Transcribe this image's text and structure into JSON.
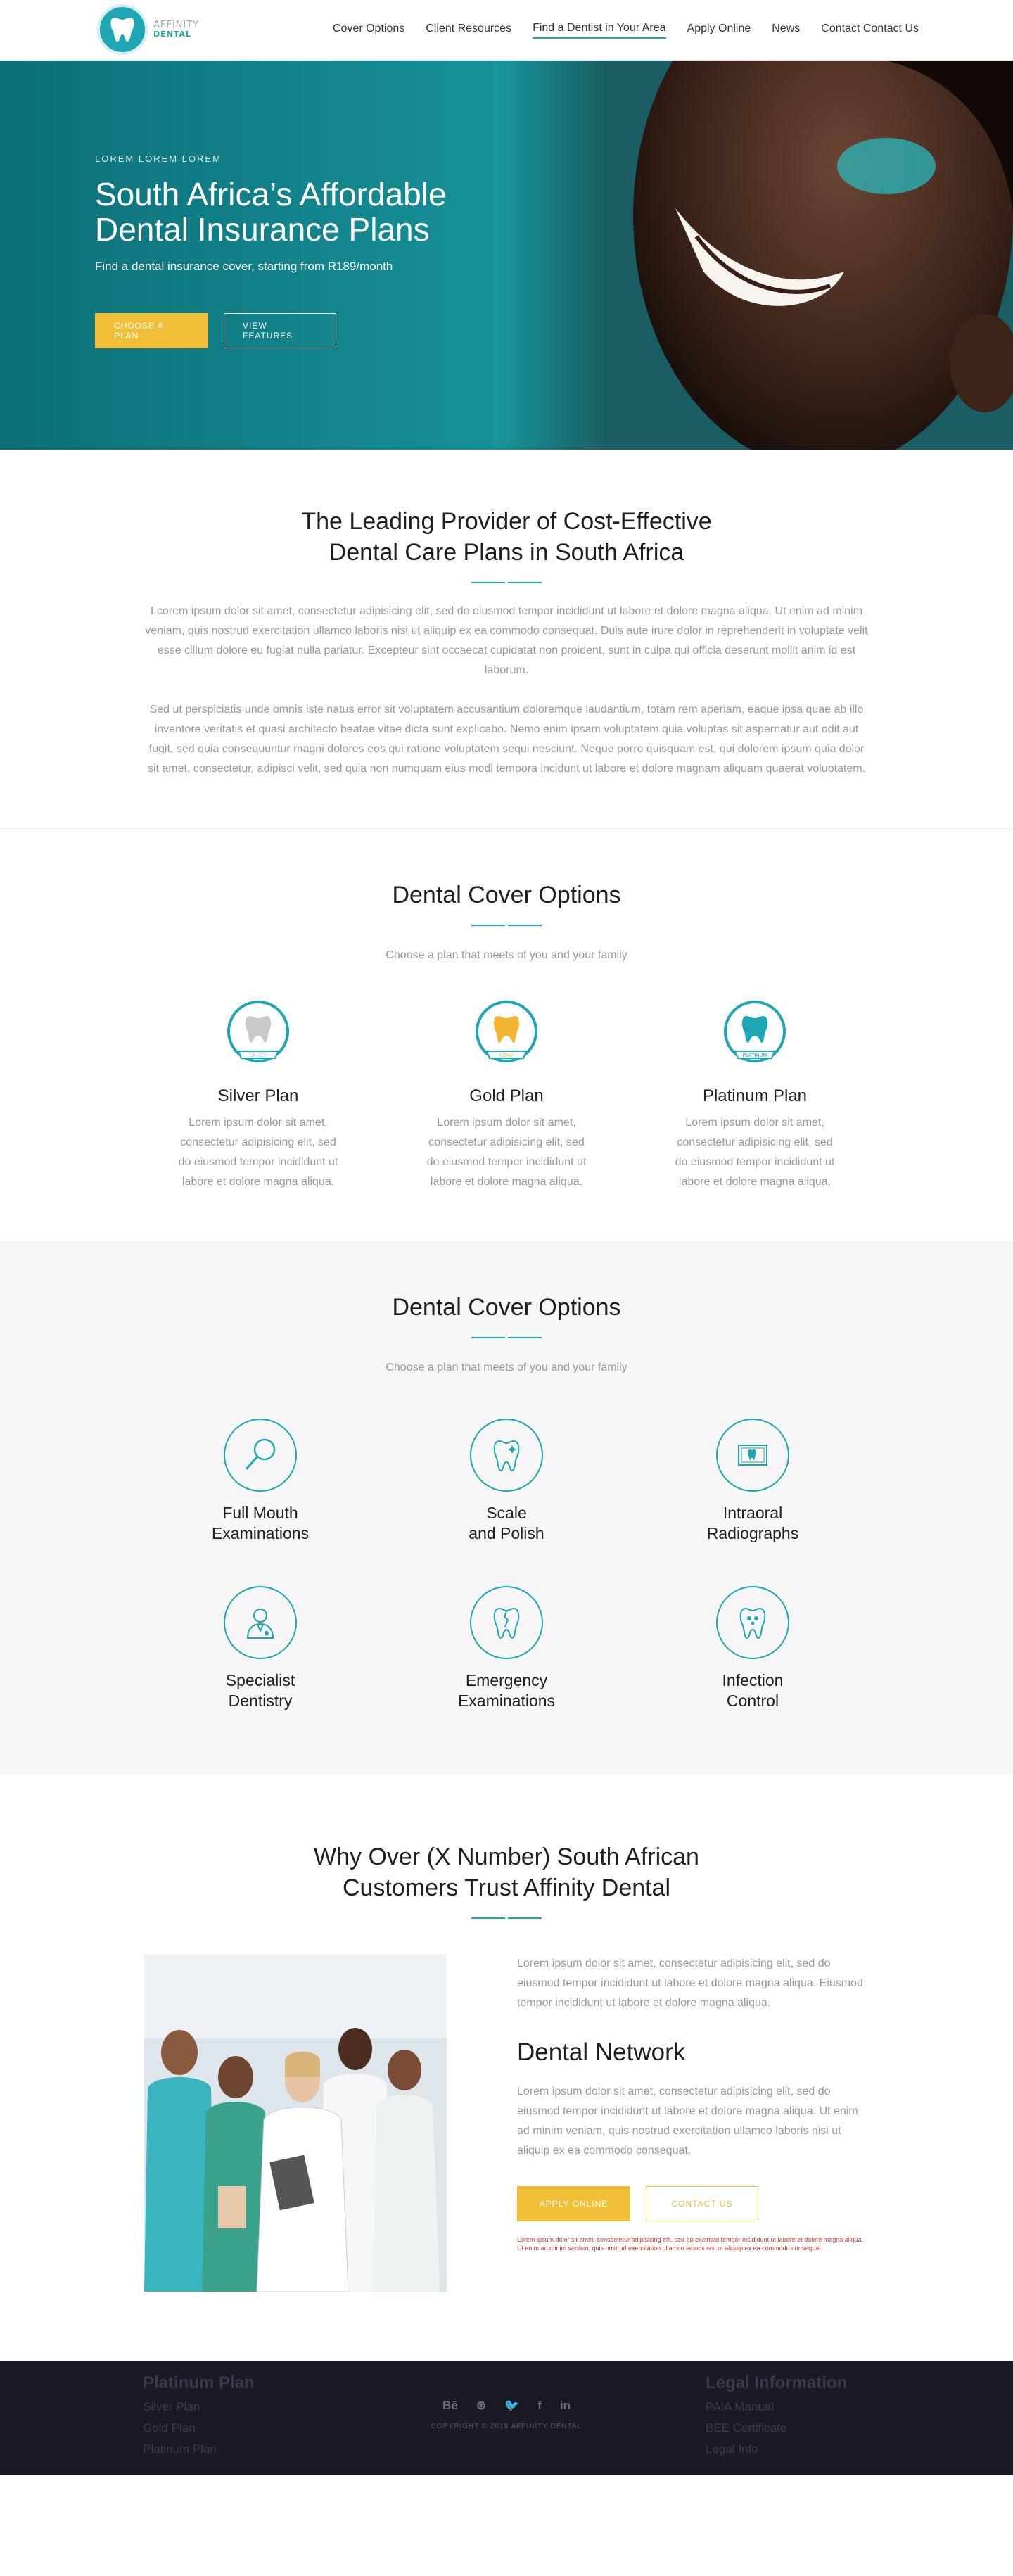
{
  "header": {
    "logo": {
      "line1": "AFFINITY",
      "line2": "DENTAL"
    },
    "nav": [
      {
        "label": "Cover Options"
      },
      {
        "label": "Client Resources"
      },
      {
        "label": "Find a Dentist in Your Area"
      },
      {
        "label": "Apply Online"
      },
      {
        "label": "News"
      },
      {
        "label": "Contact Contact Us"
      }
    ],
    "active_index": 2
  },
  "hero": {
    "eyebrow": "LOREM LOREM LOREM",
    "title": "South Africa’s Affordable Dental Insurance Plans",
    "subtitle": "Find a dental insurance cover, starting from R189/month",
    "primary_btn": "CHOOSE A PLAN",
    "secondary_btn": "VIEW FEATURES"
  },
  "intro": {
    "title_line1": "The Leading Provider of Cost-Effective",
    "title_line2": "Dental Care Plans in South Africa",
    "para1": "Lcorem ipsum dolor sit amet, consectetur adipisicing elit, sed do eiusmod tempor incididunt ut labore et dolore magna aliqua. Ut enim ad minim veniam, quis nostrud exercitation ullamco laboris nisi ut aliquip ex ea commodo consequat. Duis aute irure dolor in reprehenderit in voluptate velit esse cillum dolore eu fugiat nulla pariatur. Excepteur sint occaecat cupidatat non proident, sunt in culpa qui officia deserunt mollit anim id est laborum.",
    "para2": "Sed ut perspiciatis unde omnis iste natus error sit voluptatem accusantium doloremque laudantium, totam rem aperiam, eaque ipsa quae ab illo inventore veritatis et quasi architecto beatae vitae dicta sunt explicabo. Nemo enim ipsam voluptatem quia voluptas sit aspernatur aut odit aut fugit, sed quia consequuntur magni dolores eos qui ratione voluptatem sequi nesciunt. Neque porro quisquam est, qui dolorem ipsum quia dolor sit amet, consectetur, adipisci velit, sed quia non numquam eius modi tempora incidunt ut labore et dolore magnam aliquam quaerat voluptatem."
  },
  "cover": {
    "title": "Dental Cover Options",
    "subtitle": "Choose a plan that meets of you and your family",
    "plans": [
      {
        "name": "Silver Plan",
        "badge": "SILVER",
        "color": "#c9c9c9",
        "desc": "Lorem ipsum dolor sit amet, consectetur adipisicing elit, sed do eiusmod tempor incididunt ut labore et dolore magna aliqua."
      },
      {
        "name": "Gold Plan",
        "badge": "GOLD",
        "color": "#f2b52f",
        "desc": "Lorem ipsum dolor sit amet, consectetur adipisicing elit, sed do eiusmod tempor incididunt ut labore et dolore magna aliqua."
      },
      {
        "name": "Platinum Plan",
        "badge": "PLATINUM",
        "color": "#1fa6b4",
        "desc": "Lorem ipsum dolor sit amet, consectetur adipisicing elit, sed do eiusmod tempor incididunt ut labore et dolore magna aliqua."
      }
    ]
  },
  "features": {
    "title": "Dental Cover Options",
    "subtitle": "Choose a plan that meets of you and your family",
    "items": [
      {
        "label": "Full Mouth\nExaminations",
        "icon": "magnifier-icon"
      },
      {
        "label": "Scale\nand Polish",
        "icon": "sparkle-tooth-icon"
      },
      {
        "label": "Intraoral\nRadiographs",
        "icon": "xray-icon"
      },
      {
        "label": "Specialist\nDentistry",
        "icon": "dentist-icon"
      },
      {
        "label": "Emergency\nExaminations",
        "icon": "broken-tooth-icon"
      },
      {
        "label": "Infection\nControl",
        "icon": "infected-tooth-icon"
      }
    ]
  },
  "trust": {
    "title_line1": "Why Over (X Number) South African",
    "title_line2": "Customers Trust Affinity Dental",
    "para1": "Lorem ipsum dolor sit amet, consectetur adipisicing elit, sed do eiusmod tempor incididunt ut labore et dolore magna aliqua.  Eiusmod tempor incididunt ut labore et dolore magna aliqua.",
    "network_title": "Dental Network",
    "para2": "Lorem ipsum dolor sit amet, consectetur adipisicing elit, sed do eiusmod tempor incididunt ut labore et dolore magna aliqua. Ut enim ad minim veniam, quis nostrud exercitation ullamco laboris nisi ut aliquip ex ea commodo consequat.",
    "apply_btn": "APPLY ONLINE",
    "contact_btn": "CONTACT US",
    "disclaimer": "Lorem ipsum dolor sit amet, consectetur adipisicing elit, sed do eiusmod tempor incididunt ut labore et dolore magna aliqua. Ut enim ad minim veniam, quis nostrud exercitation ullamco laboris nisi ut aliquip ex ea commodo consequat."
  },
  "footer": {
    "left_title": "Platinum Plan",
    "left_links": [
      "Silver Plan",
      "Gold Plan",
      "Platinum Plan"
    ],
    "socials": [
      "Bē",
      "⊛",
      "🐦",
      "f",
      "in"
    ],
    "copyright": "COPYRIGHT © 2018 AFFINITY DENTAL",
    "right_title": "Legal Information",
    "right_links": [
      "PAIA Manual",
      "BEE Certificate",
      "Legal Info"
    ]
  },
  "colors": {
    "accent": "#1fa6b4",
    "button_yellow": "#f0bf37",
    "footer_bg": "#1a1a24",
    "features_bg": "#f6f6f6"
  }
}
